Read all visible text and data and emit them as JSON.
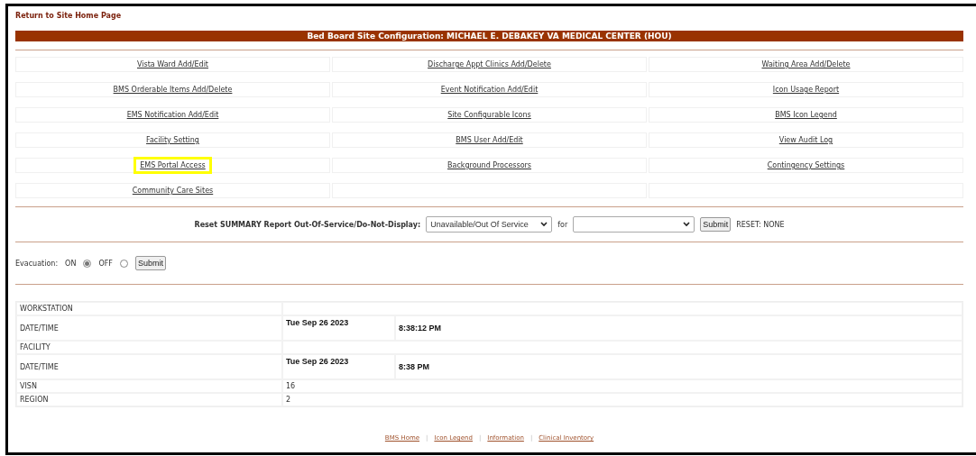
{
  "return_link": "Return to Site Home Page",
  "title": "Bed Board Site Configuration: MICHAEL E. DEBAKEY VA MEDICAL CENTER (HOU)",
  "menu_rows": [
    [
      {
        "label": "Vista Ward Add/Edit",
        "highlighted": false
      },
      {
        "label": "Discharge Appt Clinics Add/Delete",
        "highlighted": false
      },
      {
        "label": "Waiting Area Add/Delete",
        "highlighted": false
      }
    ],
    [
      {
        "label": "BMS Orderable Items Add/Delete",
        "highlighted": false
      },
      {
        "label": "Event Notification Add/Edit",
        "highlighted": false
      },
      {
        "label": "Icon Usage Report",
        "highlighted": false
      }
    ],
    [
      {
        "label": "EMS Notification Add/Edit",
        "highlighted": false
      },
      {
        "label": "Site Configurable Icons",
        "highlighted": false
      },
      {
        "label": "BMS Icon Legend",
        "highlighted": false
      }
    ],
    [
      {
        "label": "Facility Setting",
        "highlighted": false
      },
      {
        "label": "BMS User Add/Edit",
        "highlighted": false
      },
      {
        "label": "View Audit Log",
        "highlighted": false
      }
    ],
    [
      {
        "label": "EMS Portal Access",
        "highlighted": true
      },
      {
        "label": "Background Processors",
        "highlighted": false
      },
      {
        "label": "Contingency Settings",
        "highlighted": false
      }
    ],
    [
      {
        "label": "Community Care Sites",
        "highlighted": false
      }
    ]
  ],
  "reset": {
    "label": "Reset SUMMARY Report Out-Of-Service/Do-Not-Display:",
    "status_select": {
      "value": "Unavailable/Out Of Service"
    },
    "for_label": "for",
    "submit": "Submit",
    "status": "RESET: NONE"
  },
  "evacuation": {
    "label": "Evacuation:",
    "options": [
      {
        "label": "ON",
        "selected": true
      },
      {
        "label": "OFF",
        "selected": false
      }
    ],
    "submit": "Submit"
  },
  "info_rows": [
    {
      "label": "WORKSTATION"
    },
    {
      "label": "DATE/TIME",
      "date": "Tue Sep 26 2023",
      "time": "8:38:12 PM"
    },
    {
      "label": "FACILITY"
    },
    {
      "label": "DATE/TIME",
      "date": "Tue Sep 26 2023",
      "time": "8:38 PM"
    },
    {
      "label": "VISN",
      "value": "16"
    },
    {
      "label": "REGION",
      "value": "2"
    }
  ],
  "footer": [
    {
      "kind": "link",
      "text": "BMS Home"
    },
    {
      "kind": "separator",
      "text": "|"
    },
    {
      "kind": "link",
      "text": "Icon Legend"
    },
    {
      "kind": "separator",
      "text": "|"
    },
    {
      "kind": "link",
      "text": "Information"
    },
    {
      "kind": "separator",
      "text": "|"
    },
    {
      "kind": "link",
      "text": "Clinical Inventory"
    }
  ]
}
